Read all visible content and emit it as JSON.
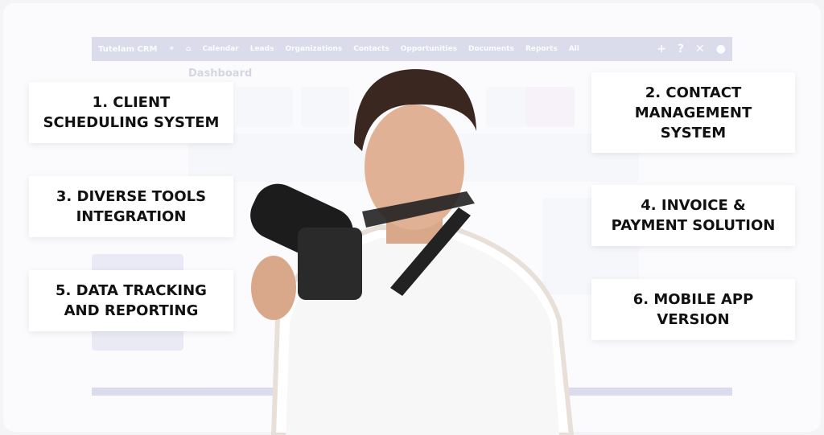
{
  "crm": {
    "brand": "Tutelam CRM",
    "nav_items": [
      "Calendar",
      "Leads",
      "Organizations",
      "Contacts",
      "Opportunities",
      "Documents",
      "Reports",
      "All"
    ],
    "dashboard_title": "Dashboard"
  },
  "features": [
    "1. CLIENT\nSCHEDULING SYSTEM",
    "2. CONTACT\nMANAGEMENT\nSYSTEM",
    "3. DIVERSE TOOLS\nINTEGRATION",
    "4. INVOICE &\nPAYMENT SOLUTION",
    "5. DATA TRACKING\nAND REPORTING",
    "6. MOBILE APP\nVERSION"
  ],
  "colors": {
    "nav": "#9ea3cf",
    "card": "#ffffff",
    "text": "#111111"
  }
}
